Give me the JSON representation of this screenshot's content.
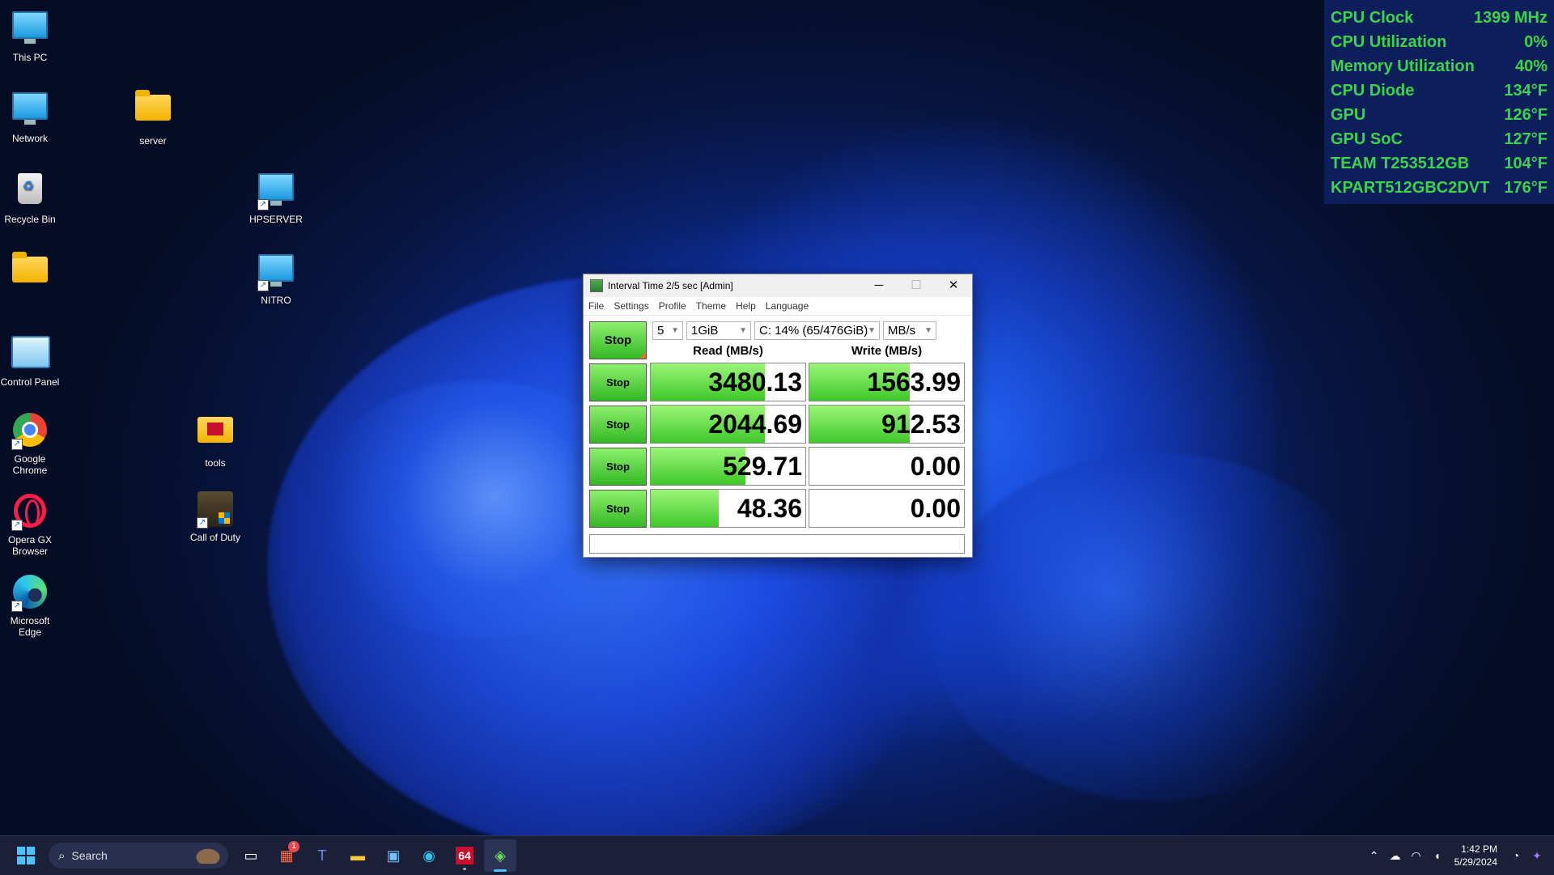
{
  "desktop": {
    "icons": [
      {
        "label": "This PC",
        "icon": "monitor-icon"
      },
      {
        "label": "Network",
        "icon": "network-icon"
      },
      {
        "label": "Recycle Bin",
        "icon": "recycle-bin-icon"
      },
      {
        "label": "",
        "icon": "folder-icon"
      },
      {
        "label": "Control Panel",
        "icon": "control-panel-icon"
      },
      {
        "label": "Google Chrome",
        "icon": "chrome-icon"
      },
      {
        "label": "Opera GX Browser",
        "icon": "opera-gx-icon"
      },
      {
        "label": "Microsoft Edge",
        "icon": "edge-icon"
      },
      {
        "label": "server",
        "icon": "folder-icon"
      },
      {
        "label": "HPSERVER",
        "icon": "monitor-icon"
      },
      {
        "label": "NITRO",
        "icon": "monitor-icon"
      },
      {
        "label": "tools",
        "icon": "folder-icon"
      },
      {
        "label": "Call of Duty",
        "icon": "call-of-duty-icon"
      }
    ]
  },
  "overlay": {
    "rows": [
      {
        "label": "CPU Clock",
        "value": "1399 MHz"
      },
      {
        "label": "CPU Utilization",
        "value": "0%"
      },
      {
        "label": "Memory Utilization",
        "value": "40%"
      },
      {
        "label": "CPU Diode",
        "value": "134°F"
      },
      {
        "label": "GPU",
        "value": "126°F"
      },
      {
        "label": "GPU SoC",
        "value": "127°F"
      },
      {
        "label": "TEAM T253512GB",
        "value": "104°F"
      },
      {
        "label": "KPART512GBC2DVT",
        "value": "176°F"
      }
    ],
    "color": "#3bd34b"
  },
  "window": {
    "title": "Interval Time 2/5 sec [Admin]",
    "buttons": {
      "minimize": "─",
      "maximize": "☐",
      "close": "✕"
    },
    "menu": [
      "File",
      "Settings",
      "Profile",
      "Theme",
      "Help",
      "Language"
    ],
    "all_button": "Stop",
    "count": "5",
    "size": "1GiB",
    "drive": "C: 14% (65/476GiB)",
    "unit": "MB/s",
    "read_header": "Read (MB/s)",
    "write_header": "Write (MB/s)",
    "rows": [
      {
        "button": "Stop",
        "read": "3480.13",
        "write": "1563.99",
        "read_fill": 0.74,
        "write_fill": 0.65
      },
      {
        "button": "Stop",
        "read": "2044.69",
        "write": "912.53",
        "read_fill": 0.74,
        "write_fill": 0.65
      },
      {
        "button": "Stop",
        "read": "529.71",
        "write": "0.00",
        "read_fill": 0.61,
        "write_fill": 0
      },
      {
        "button": "Stop",
        "read": "48.36",
        "write": "0.00",
        "read_fill": 0.44,
        "write_fill": 0
      }
    ],
    "comment": ""
  },
  "taskbar": {
    "search_placeholder": "Search",
    "apps": [
      {
        "name": "task-view",
        "badge": ""
      },
      {
        "name": "app-with-badge",
        "badge": "1"
      },
      {
        "name": "teams",
        "badge": ""
      },
      {
        "name": "file-explorer",
        "badge": ""
      },
      {
        "name": "microsoft-store",
        "badge": ""
      },
      {
        "name": "edge",
        "badge": ""
      },
      {
        "name": "aida64",
        "badge": ""
      },
      {
        "name": "crystaldiskmark",
        "badge": ""
      }
    ],
    "aida_label": "64",
    "time": "1:42 PM",
    "date": "5/29/2024"
  }
}
